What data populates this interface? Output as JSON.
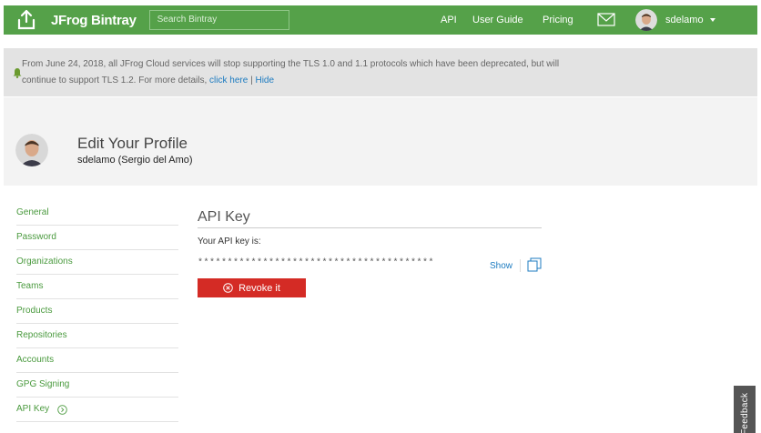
{
  "header": {
    "brand": "JFrog Bintray",
    "search_placeholder": "Search Bintray",
    "nav": {
      "api": "API",
      "user_guide": "User Guide",
      "pricing": "Pricing"
    },
    "username": "sdelamo"
  },
  "notice": {
    "line1": "From June 24, 2018, all JFrog Cloud services will stop supporting the TLS 1.0 and 1.1 protocols which have been deprecated, but will",
    "line2_prefix": "continue to support TLS 1.2. For more details, ",
    "click_here": "click here",
    "divider": "|",
    "hide": "Hide"
  },
  "profile": {
    "title": "Edit Your Profile",
    "subtitle": "sdelamo (Sergio del Amo)"
  },
  "sidebar": {
    "items": [
      {
        "label": "General"
      },
      {
        "label": "Password"
      },
      {
        "label": "Organizations"
      },
      {
        "label": "Teams"
      },
      {
        "label": "Products"
      },
      {
        "label": "Repositories"
      },
      {
        "label": "Accounts"
      },
      {
        "label": "GPG Signing"
      },
      {
        "label": "API Key",
        "active": true
      }
    ]
  },
  "main": {
    "section_title": "API Key",
    "key_label": "Your API key is:",
    "key_masked": "****************************************",
    "show_label": "Show",
    "revoke_label": "Revoke it"
  },
  "feedback_label": "Feedback",
  "colors": {
    "brand_green": "#55a149",
    "link_green": "#4a9a3e",
    "link_blue": "#1c7bc0",
    "danger": "#d42b25"
  },
  "icons": [
    "bintray-logo-icon",
    "mail-icon",
    "bell-icon",
    "copy-icon",
    "revoke-x-icon",
    "chevron-right-icon",
    "caret-down-icon"
  ]
}
